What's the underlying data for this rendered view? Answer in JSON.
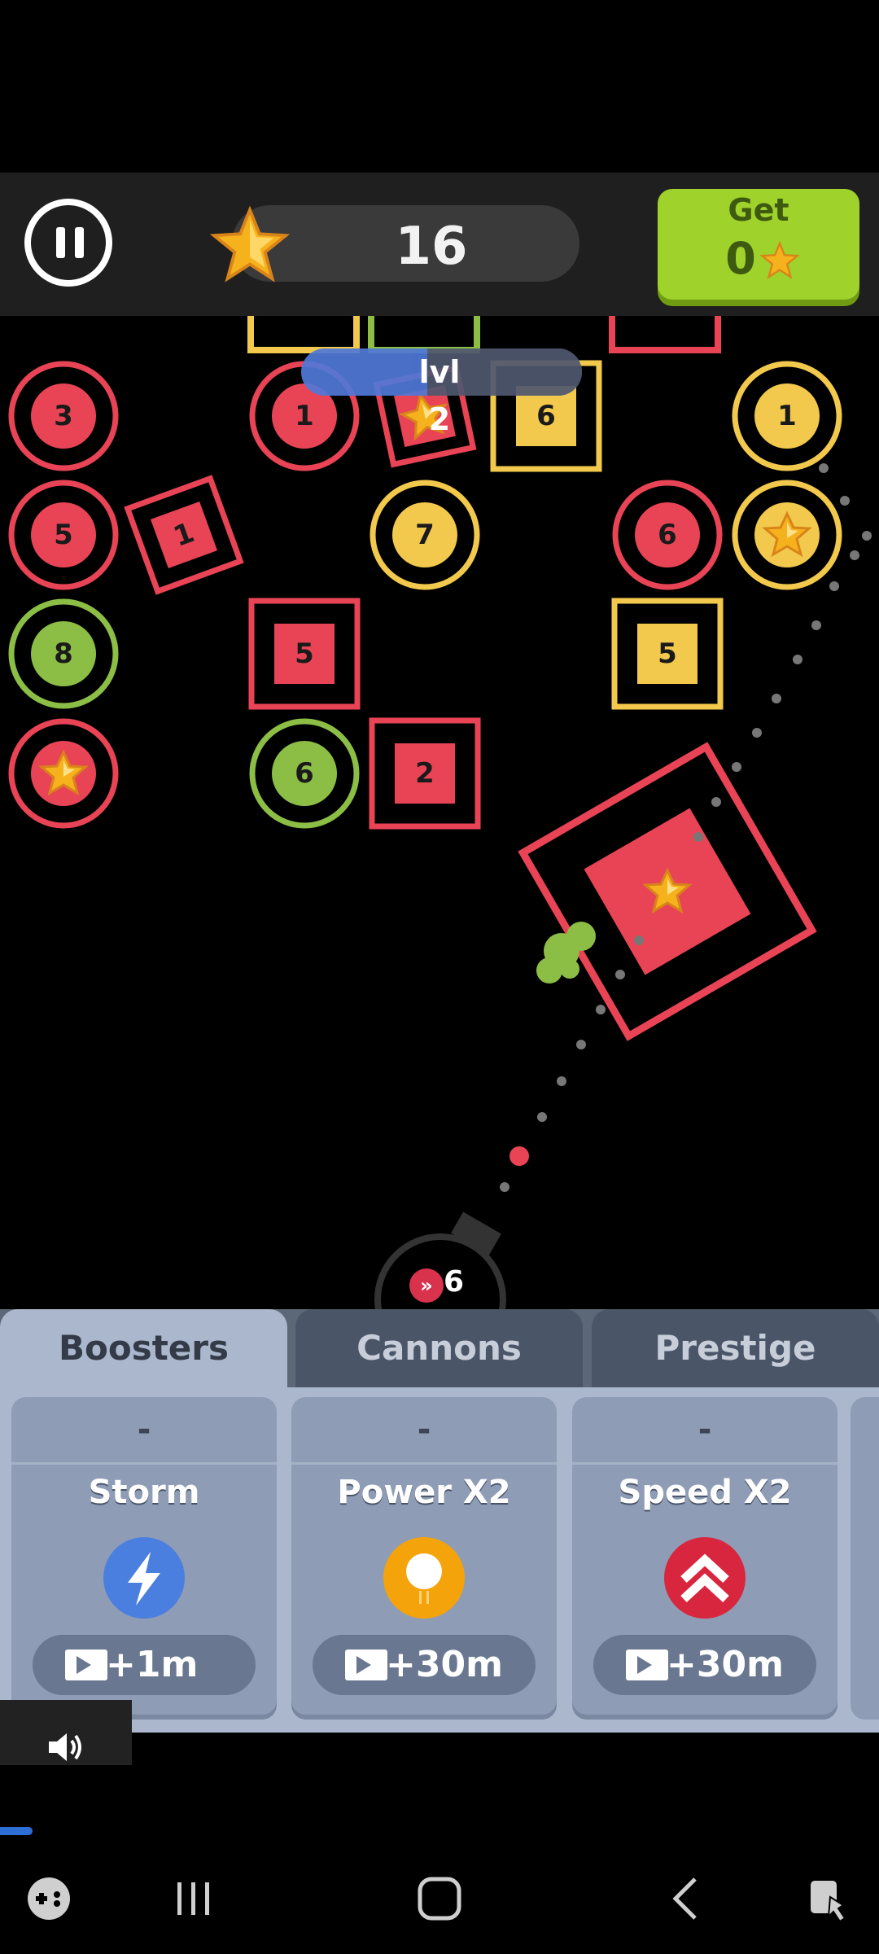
{
  "hud": {
    "score": "16",
    "get_label": "Get",
    "get_value": "0",
    "level": "lvl 2"
  },
  "colors": {
    "red": "#e84455",
    "yellow": "#f2c94c",
    "green": "#8cbe46",
    "accent_green": "#9fd22b"
  },
  "bricks": [
    {
      "shape": "circle",
      "color": "red",
      "label": "3"
    },
    {
      "shape": "circle",
      "color": "red",
      "label": "1"
    },
    {
      "shape": "square",
      "color": "red",
      "label": "star",
      "rotated": true
    },
    {
      "shape": "square",
      "color": "yellow",
      "label": "6"
    },
    {
      "shape": "circle",
      "color": "yellow",
      "label": "1"
    },
    {
      "shape": "circle",
      "color": "red",
      "label": "5"
    },
    {
      "shape": "square",
      "color": "red",
      "label": "1",
      "rotated": true
    },
    {
      "shape": "circle",
      "color": "yellow",
      "label": "7"
    },
    {
      "shape": "circle",
      "color": "red",
      "label": "6"
    },
    {
      "shape": "circle",
      "color": "yellow",
      "label": "star"
    },
    {
      "shape": "circle",
      "color": "green",
      "label": "8"
    },
    {
      "shape": "square",
      "color": "red",
      "label": "5"
    },
    {
      "shape": "square",
      "color": "yellow",
      "label": "5"
    },
    {
      "shape": "circle",
      "color": "red",
      "label": "star"
    },
    {
      "shape": "circle",
      "color": "green",
      "label": "6"
    },
    {
      "shape": "square",
      "color": "red",
      "label": "2"
    },
    {
      "shape": "square",
      "color": "red",
      "label": "star",
      "rotated": true,
      "large": true
    }
  ],
  "cannon": {
    "count": "6",
    "icon": "speed-chevron-icon"
  },
  "tabs": [
    {
      "label": "Boosters",
      "active": true
    },
    {
      "label": "Cannons",
      "active": false
    },
    {
      "label": "Prestige",
      "active": false
    }
  ],
  "boosters": [
    {
      "level": "-",
      "name": "Storm",
      "icon": "lightning-icon",
      "icon_color": "#4a7fe0",
      "reward": "+1m"
    },
    {
      "level": "-",
      "name": "Power X2",
      "icon": "power-ball-icon",
      "icon_color": "#f5a30a",
      "reward": "+30m"
    },
    {
      "level": "-",
      "name": "Speed X2",
      "icon": "double-chevron-icon",
      "icon_color": "#d8263e",
      "reward": "+30m"
    }
  ],
  "nav": [
    "game-launcher-icon",
    "recents-icon",
    "home-icon",
    "back-icon",
    "screen-lock-icon"
  ]
}
